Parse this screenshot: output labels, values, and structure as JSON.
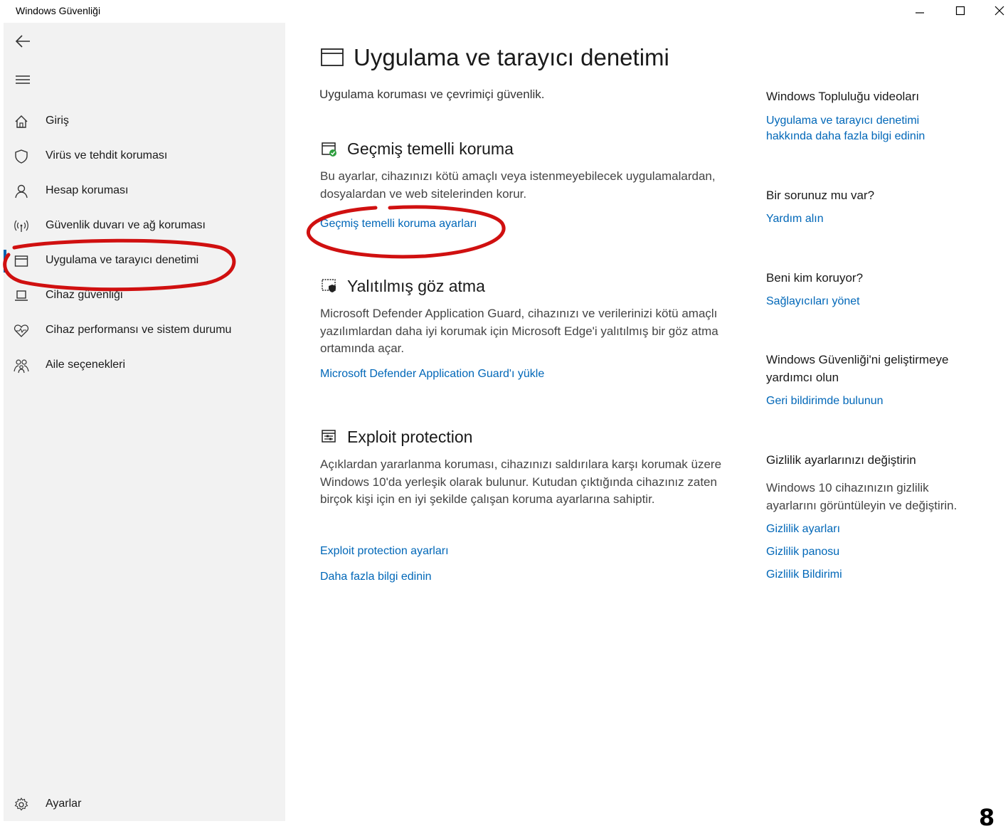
{
  "window": {
    "title": "Windows Güvenliği"
  },
  "sidebar": {
    "items": [
      {
        "label": "Giriş",
        "icon": "home-icon"
      },
      {
        "label": "Virüs ve tehdit koruması",
        "icon": "shield-icon"
      },
      {
        "label": "Hesap koruması",
        "icon": "person-icon"
      },
      {
        "label": "Güvenlik duvarı ve ağ koruması",
        "icon": "antenna-icon"
      },
      {
        "label": "Uygulama ve tarayıcı denetimi",
        "icon": "app-window-icon",
        "active": true
      },
      {
        "label": "Cihaz güvenliği",
        "icon": "laptop-icon"
      },
      {
        "label": "Cihaz performansı ve sistem durumu",
        "icon": "heart-icon"
      },
      {
        "label": "Aile seçenekleri",
        "icon": "family-icon"
      }
    ],
    "settings_label": "Ayarlar"
  },
  "main": {
    "title": "Uygulama ve tarayıcı denetimi",
    "subtitle": "Uygulama koruması ve çevrimiçi güvenlik.",
    "sections": [
      {
        "title": "Geçmiş temelli koruma",
        "description": "Bu ayarlar, cihazınızı kötü amaçlı veya istenmeyebilecek uygulamalardan, dosyalardan ve web sitelerinden korur.",
        "links": [
          "Geçmiş temelli koruma ayarları"
        ]
      },
      {
        "title": "Yalıtılmış göz atma",
        "description": "Microsoft Defender Application Guard, cihazınızı ve verilerinizi kötü amaçlı yazılımlardan daha iyi korumak için Microsoft Edge'i yalıtılmış bir göz atma ortamında açar.",
        "links": [
          "Microsoft Defender Application Guard'ı yükle"
        ]
      },
      {
        "title": "Exploit protection",
        "description": "Açıklardan yararlanma koruması, cihazınızı saldırılara karşı korumak üzere Windows 10'da yerleşik olarak bulunur. Kutudan çıktığında cihazınız zaten birçok kişi için en iyi şekilde çalışan koruma ayarlarına sahiptir.",
        "links": [
          "Exploit protection ayarları",
          "Daha fazla bilgi edinin"
        ]
      }
    ]
  },
  "rail": {
    "community_title": "Windows Topluluğu videoları",
    "community_link": "Uygulama ve tarayıcı denetimi hakkında daha fazla bilgi edinin",
    "question_title": "Bir sorunuz mu var?",
    "question_link": "Yardım alın",
    "protect_title": "Beni kim koruyor?",
    "protect_link": "Sağlayıcıları yönet",
    "feedback_title": "Windows Güvenliği'ni geliştirmeye yardımcı olun",
    "feedback_link": "Geri bildirimde bulunun",
    "privacy_title": "Gizlilik ayarlarınızı değiştirin",
    "privacy_text": "Windows 10 cihazınızın gizlilik ayarlarını görüntüleyin ve değiştirin.",
    "privacy_links": [
      "Gizlilik ayarları",
      "Gizlilik panosu",
      "Gizlilik Bildirimi"
    ]
  },
  "annotation": {
    "corner_mark": "8",
    "highlight_color": "#d01010"
  },
  "colors": {
    "link": "#0067b8",
    "sidebar_bg": "#f2f2f2",
    "active_indicator": "#0063b1"
  }
}
